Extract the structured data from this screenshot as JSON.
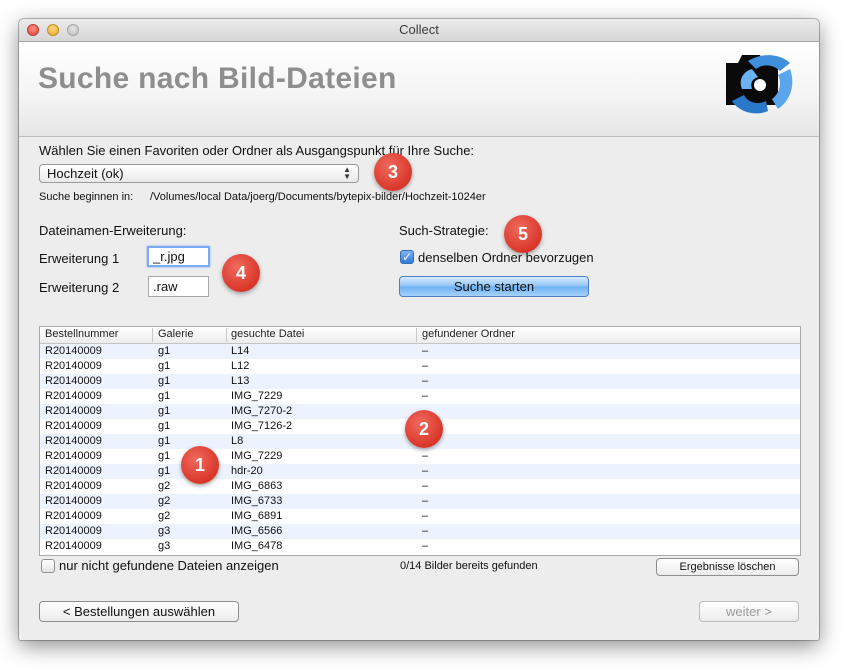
{
  "window": {
    "title": "Collect"
  },
  "header": {
    "title": "Suche nach Bild-Dateien"
  },
  "source": {
    "prompt": "Wählen Sie einen Favoriten oder Ordner als Ausgangspunkt für Ihre Suche:",
    "selected": "Hochzeit (ok)",
    "start_label": "Suche beginnen in:",
    "start_path": "/Volumes/local Data/joerg/Documents/bytepix-bilder/Hochzeit-1024er"
  },
  "extensions": {
    "heading": "Dateinamen-Erweiterung:",
    "ext1_label": "Erweiterung 1",
    "ext1_value": "_r.jpg",
    "ext2_label": "Erweiterung 2",
    "ext2_value": ".raw"
  },
  "strategy": {
    "heading": "Such-Strategie:",
    "same_folder_label": "denselben Ordner bevorzugen",
    "same_folder_checked": true,
    "start_button": "Suche starten"
  },
  "table": {
    "columns": [
      "Bestellnummer",
      "Galerie",
      "gesuchte Datei",
      "gefundener Ordner"
    ],
    "rows": [
      [
        "R20140009",
        "g1",
        "L14",
        "–"
      ],
      [
        "R20140009",
        "g1",
        "L12",
        "–"
      ],
      [
        "R20140009",
        "g1",
        "L13",
        "–"
      ],
      [
        "R20140009",
        "g1",
        "IMG_7229",
        "–"
      ],
      [
        "R20140009",
        "g1",
        "IMG_7270-2",
        ""
      ],
      [
        "R20140009",
        "g1",
        "IMG_7126-2",
        ""
      ],
      [
        "R20140009",
        "g1",
        "L8",
        ""
      ],
      [
        "R20140009",
        "g1",
        "IMG_7229",
        "–"
      ],
      [
        "R20140009",
        "g1",
        "hdr-20",
        "–"
      ],
      [
        "R20140009",
        "g2",
        "IMG_6863",
        "–"
      ],
      [
        "R20140009",
        "g2",
        "IMG_6733",
        "–"
      ],
      [
        "R20140009",
        "g2",
        "IMG_6891",
        "–"
      ],
      [
        "R20140009",
        "g3",
        "IMG_6566",
        "–"
      ],
      [
        "R20140009",
        "g3",
        "IMG_6478",
        "–"
      ]
    ]
  },
  "footer": {
    "only_missing_label": "nur nicht gefundene Dateien anzeigen",
    "status": "0/14 Bilder bereits gefunden",
    "clear_button": "Ergebnisse löschen",
    "back_button": "< Bestellungen auswählen",
    "next_button": "weiter >"
  },
  "badges": [
    "1",
    "2",
    "3",
    "4",
    "5"
  ],
  "colors": {
    "badge": "#d93629",
    "accent_blue": "#6cb1f3",
    "header_text": "#8e8e8e"
  }
}
